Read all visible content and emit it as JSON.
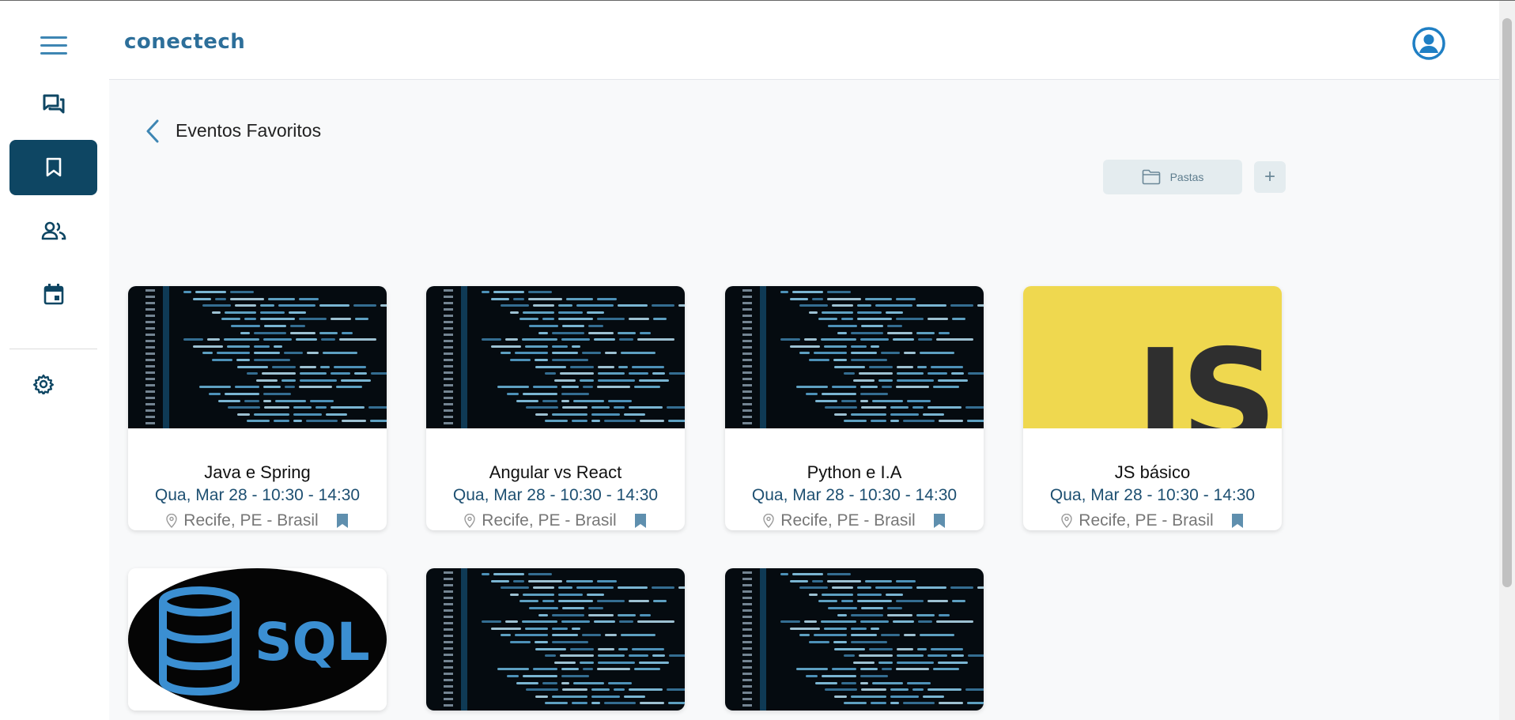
{
  "app": {
    "logo": "conectech"
  },
  "sidebar": {
    "items": [
      {
        "name": "menu-icon"
      },
      {
        "name": "chat-icon"
      },
      {
        "name": "bookmark-icon",
        "active": true
      },
      {
        "name": "people-icon"
      },
      {
        "name": "calendar-icon"
      },
      {
        "name": "settings-icon"
      }
    ]
  },
  "page": {
    "title": "Eventos Favoritos"
  },
  "folders": {
    "label": "Pastas",
    "add_label": "+"
  },
  "events": [
    {
      "title": "Java e Spring",
      "date": "Qua, Mar 28 - 10:30 - 14:30",
      "location": "Recife, PE - Brasil",
      "image": "code"
    },
    {
      "title": "Angular vs React",
      "date": "Qua, Mar 28 - 10:30 - 14:30",
      "location": "Recife, PE - Brasil",
      "image": "code"
    },
    {
      "title": "Python e I.A",
      "date": "Qua, Mar 28 - 10:30 - 14:30",
      "location": "Recife, PE - Brasil",
      "image": "code"
    },
    {
      "title": "JS básico",
      "date": "Qua, Mar 28 - 10:30 - 14:30",
      "location": "Recife, PE - Brasil",
      "image": "js"
    },
    {
      "image": "sql"
    },
    {
      "image": "code"
    },
    {
      "image": "code"
    }
  ],
  "thumb_text": {
    "js": "JS",
    "sql": "SQL"
  },
  "colors": {
    "primary": "#0e4663",
    "accent": "#2d6f9a",
    "date": "#1d4f71",
    "bookmark": "#5f8fae"
  }
}
